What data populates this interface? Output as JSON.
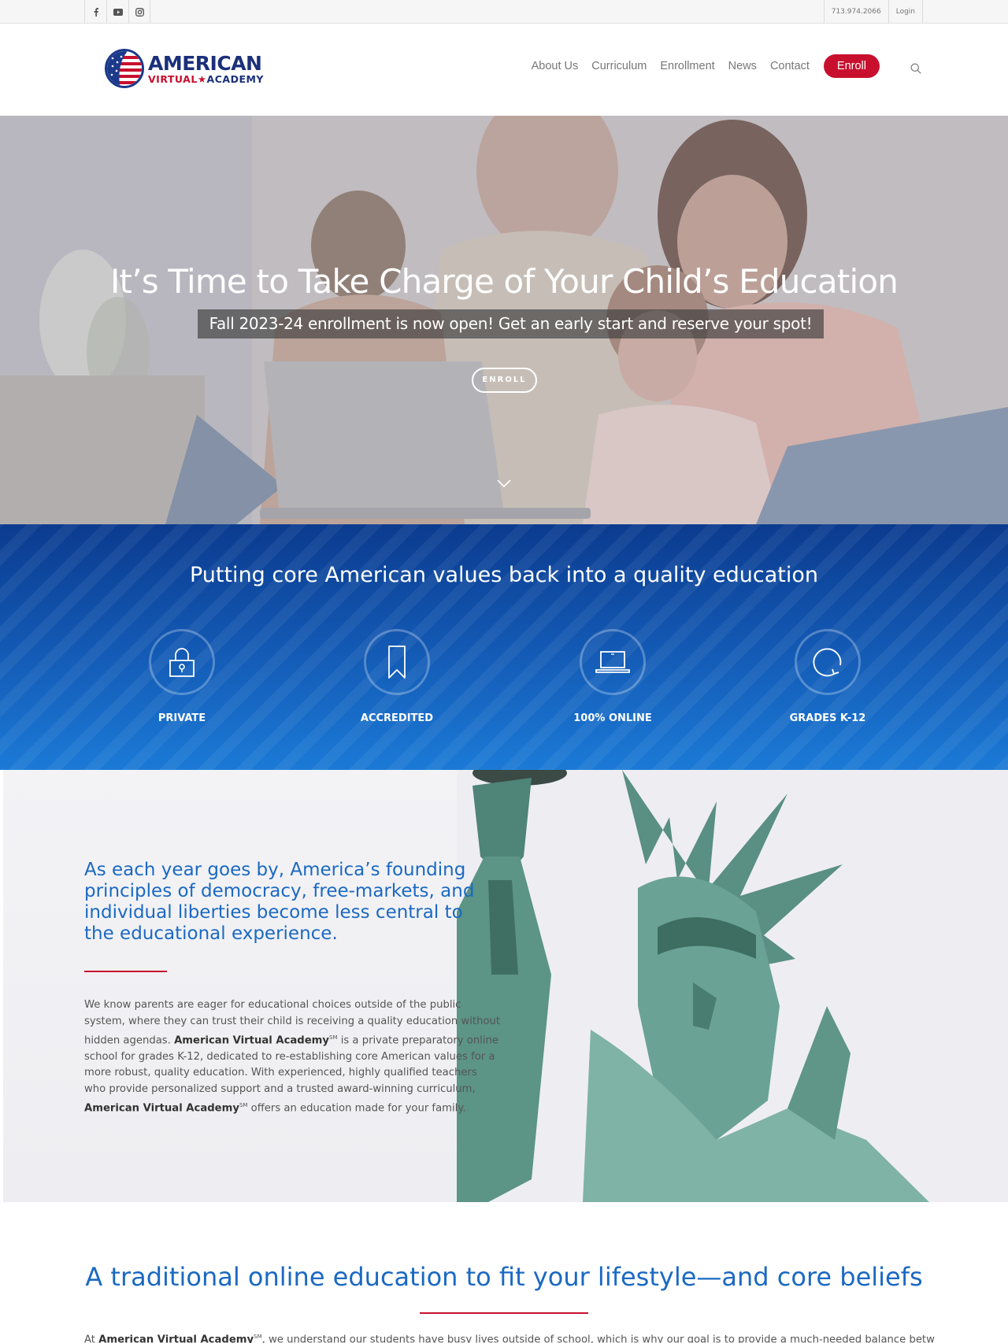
{
  "topbar": {
    "social_icons": [
      "facebook-icon",
      "youtube-icon",
      "instagram-icon"
    ],
    "phone": "713.974.2066",
    "login": "Login"
  },
  "header": {
    "logo": {
      "line1": "AMERICAN",
      "line2_a": "VIRTUAL",
      "line2_star": "★",
      "line2_b": "ACADEMY"
    },
    "nav": [
      "About Us",
      "Curriculum",
      "Enrollment",
      "News",
      "Contact"
    ],
    "enroll_button": "Enroll"
  },
  "hero": {
    "title": "It’s Time to Take Charge of Your Child’s Education",
    "subtitle": "Fall 2023-24 enrollment is now open! Get an early start and reserve your spot!",
    "button": "ENROLL"
  },
  "values": {
    "heading": "Putting core American values back into a quality education",
    "items": [
      {
        "label": "PRIVATE",
        "icon": "lock-icon"
      },
      {
        "label": "ACCREDITED",
        "icon": "bookmark-icon"
      },
      {
        "label": "100% ONLINE",
        "icon": "laptop-icon"
      },
      {
        "label": "GRADES K-12",
        "icon": "refresh-icon"
      }
    ]
  },
  "liberty": {
    "intro": "As each year goes by, America’s founding principles of democracy, free-markets, and individual liberties become less central to the educational experience.",
    "body_p1": "We know parents are eager for educational choices outside of the public system, where they can trust their child is receiving a quality education without hidden agendas. ",
    "body_brand": "American Virtual Academy",
    "body_sm": "SM",
    "body_p2": " is a private preparatory online school for grades K-12, dedicated to re-establishing core American values for a more robust, quality education. With experienced, highly qualified teachers who provide personalized support and a trusted award-winning curriculum, ",
    "body_p3": " offers an education made for your family."
  },
  "bottom": {
    "heading": "A traditional online education to fit your lifestyle—and core beliefs",
    "text_prefix": "At ",
    "text_brand": "American Virtual Academy",
    "text_sm": "SM",
    "text_rest": ", we understand our students have busy lives outside of school, which is why our goal is to provide a much-needed balance between"
  },
  "colors": {
    "brand_red": "#c8102e",
    "brand_blue": "#1b69c2",
    "navy": "#1b2f7a"
  }
}
